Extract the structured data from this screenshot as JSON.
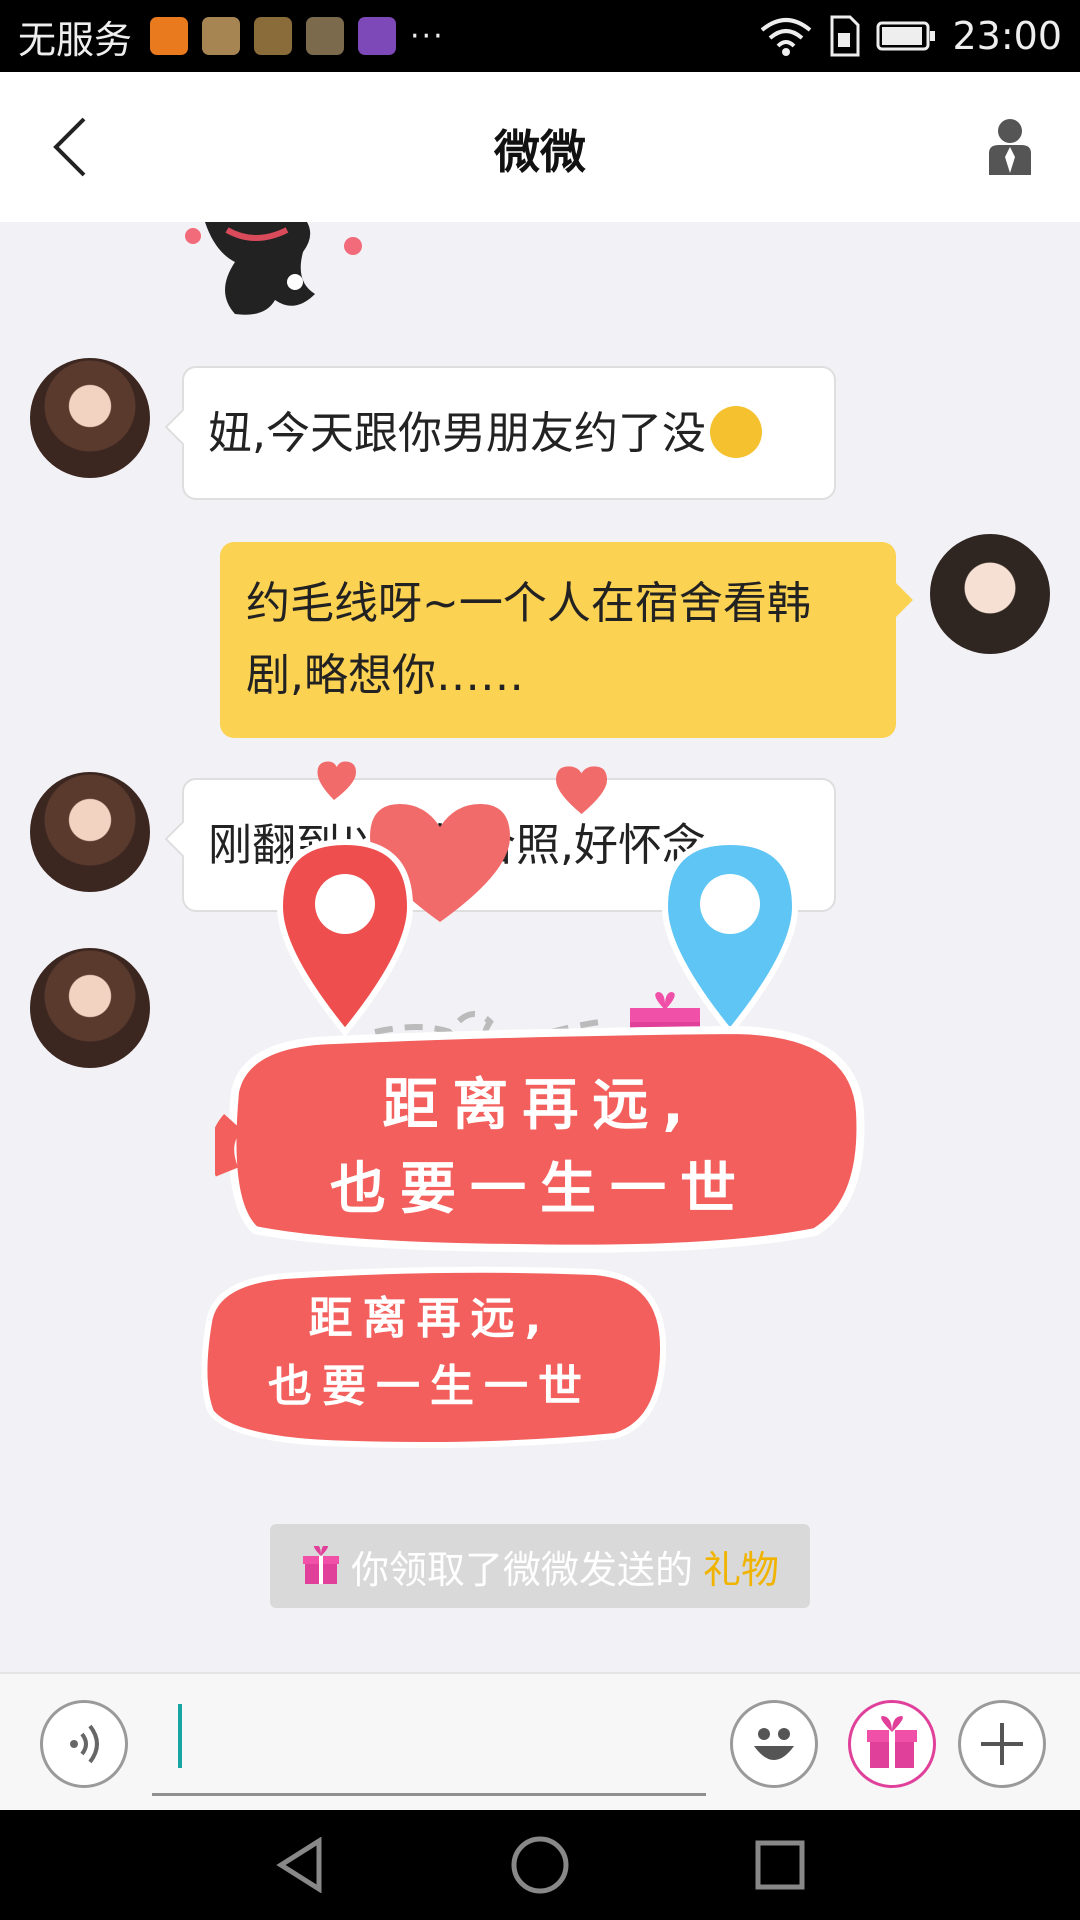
{
  "status_bar": {
    "carrier": "无服务",
    "more": "···",
    "time": "23:00"
  },
  "header": {
    "title": "微微"
  },
  "messages": [
    {
      "from": "微微",
      "text": "妞,今天跟你男朋友约了没"
    },
    {
      "from": "me",
      "line1": "约毛线呀~一个人在宿舍看韩",
      "line2": "剧,略想你……"
    },
    {
      "from": "微微",
      "text": "刚翻到以前的合照,好怀念"
    }
  ],
  "sticker": {
    "gift_open": "开",
    "main_line1": "距离再远,",
    "main_line2": "也要一生一世",
    "small_line1": "距离再远,",
    "small_line2": "也要一生一世"
  },
  "notice": {
    "text": "你领取了微微发送的",
    "highlight": "礼物"
  },
  "input": {
    "placeholder": ""
  },
  "colors": {
    "accent_yellow": "#fcd252",
    "sticker_red": "#f25f5c",
    "pin_red": "#ef4e4e",
    "pin_blue": "#5ec5f5",
    "gift_pink": "#e0409a",
    "highlight": "#f0b400"
  }
}
